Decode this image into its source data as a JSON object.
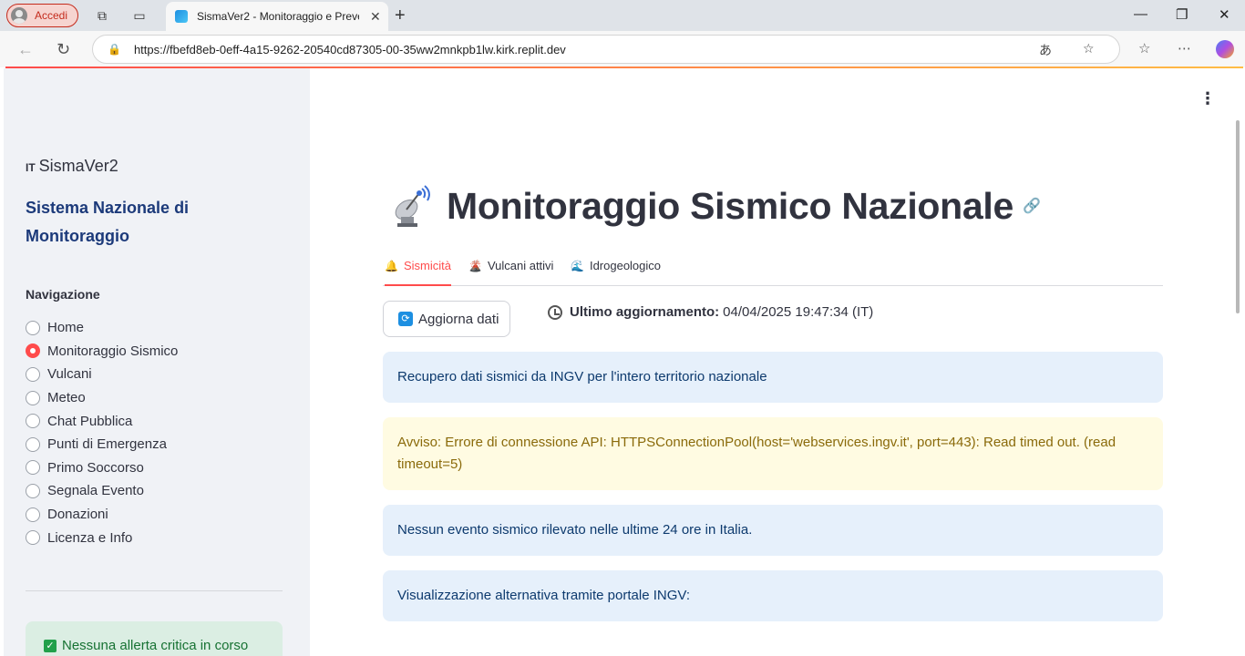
{
  "browser": {
    "profile_label": "Accedi",
    "tab_title": "SismaVer2 - Monitoraggio e Prevenzione",
    "url": "https://fbefd8eb-0eff-4a15-9262-20540cd87305-00-35ww2mnkpb1lw.kirk.replit.dev"
  },
  "sidebar": {
    "brand_prefix": "IT",
    "brand": "SismaVer2",
    "subtitle": "Sistema Nazionale di Monitoraggio",
    "nav_title": "Navigazione",
    "items": [
      {
        "label": "Home",
        "selected": false
      },
      {
        "label": "Monitoraggio Sismico",
        "selected": true
      },
      {
        "label": "Vulcani",
        "selected": false
      },
      {
        "label": "Meteo",
        "selected": false
      },
      {
        "label": "Chat Pubblica",
        "selected": false
      },
      {
        "label": "Punti di Emergenza",
        "selected": false
      },
      {
        "label": "Primo Soccorso",
        "selected": false
      },
      {
        "label": "Segnala Evento",
        "selected": false
      },
      {
        "label": "Donazioni",
        "selected": false
      },
      {
        "label": "Licenza e Info",
        "selected": false
      }
    ],
    "status_message": "Nessuna allerta critica in corso"
  },
  "main": {
    "title_icon": "satellite-antenna-icon",
    "title": "Monitoraggio Sismico Nazionale",
    "tabs": [
      {
        "label": "Sismicità",
        "icon": "bell-icon",
        "active": true
      },
      {
        "label": "Vulcani attivi",
        "icon": "volcano-icon",
        "active": false
      },
      {
        "label": "Idrogeologico",
        "icon": "wave-icon",
        "active": false
      }
    ],
    "refresh_label": "Aggiorna dati",
    "last_update_label": "Ultimo aggiornamento:",
    "last_update_value": "04/04/2025 19:47:34 (IT)",
    "info_fetch": "Recupero dati sismici da INGV per l'intero territorio nazionale",
    "warning": "Avviso: Errore di connessione API: HTTPSConnectionPool(host='webservices.ingv.it', port=443): Read timed out. (read timeout=5)",
    "info_no_events": "Nessun evento sismico rilevato nelle ultime 24 ore in Italia.",
    "info_alt": "Visualizzazione alternativa tramite portale INGV:"
  },
  "colors": {
    "accent": "#ff4b4b",
    "sidebar_bg": "#f0f2f6",
    "info_bg": "#e6f0fb",
    "warning_bg": "#fffbe2",
    "success_bg": "#dbeee3"
  }
}
